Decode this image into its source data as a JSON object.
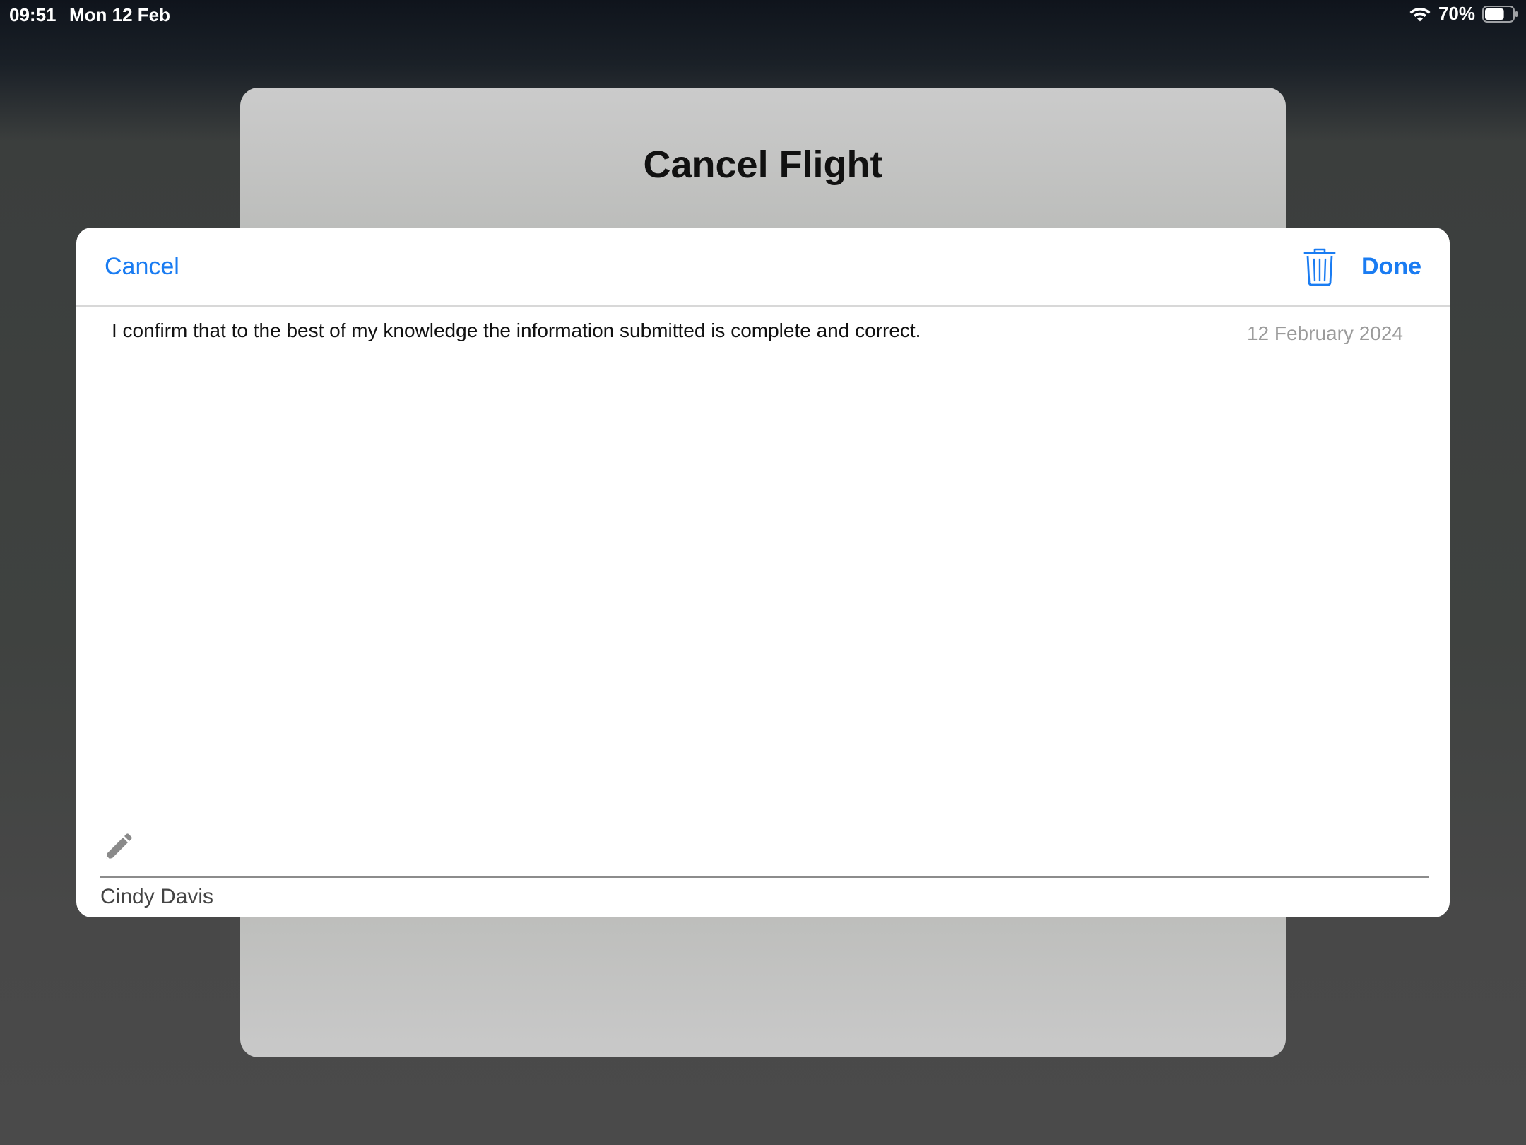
{
  "status_bar": {
    "time": "09:51",
    "date": "Mon 12 Feb",
    "battery_percent": "70%",
    "battery_level": 0.7,
    "icons": [
      "wifi-icon",
      "battery-icon"
    ]
  },
  "background_sheet": {
    "title": "Cancel Flight"
  },
  "signature_modal": {
    "cancel_label": "Cancel",
    "done_label": "Done",
    "trash_icon": "trash-icon",
    "confirmation_text": "I confirm that to the best of my knowledge the information submitted is complete and correct.",
    "date": "12 February 2024",
    "pencil_icon": "pencil-icon",
    "signer_name": "Cindy Davis"
  },
  "colors": {
    "accent": "#1a7cf2",
    "date_text": "#9b9b9b",
    "signature_line": "#8c8c8c"
  }
}
